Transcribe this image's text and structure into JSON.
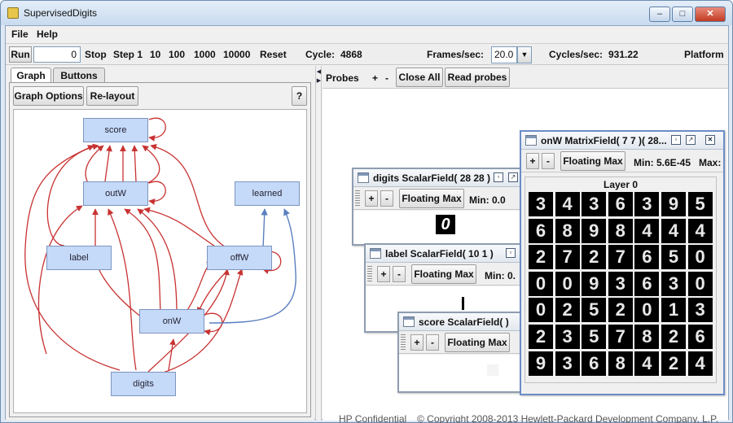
{
  "window": {
    "title": "SupervisedDigits"
  },
  "menu": [
    "File",
    "Help"
  ],
  "toolbar": {
    "run": "Run",
    "cycle_input": "0",
    "stop": "Stop",
    "step1": "Step 1",
    "s10": "10",
    "s100": "100",
    "s1000": "1000",
    "s10000": "10000",
    "reset": "Reset",
    "cycle_label": "Cycle:",
    "cycle_value": "4868",
    "fps_label": "Frames/sec:",
    "fps_value": "20.0",
    "cps_label": "Cycles/sec:",
    "cps_value": "931.22",
    "platform": "Platform"
  },
  "left": {
    "tabs": [
      "Graph",
      "Buttons"
    ],
    "graph_options": "Graph Options",
    "relayout": "Re-layout",
    "help": "?",
    "nodes": [
      "score",
      "outW",
      "learned",
      "label",
      "offW",
      "onW",
      "digits"
    ]
  },
  "probes": {
    "label": "Probes",
    "plus": "+",
    "minus": "-",
    "close_all": "Close All",
    "read_probes": "Read probes"
  },
  "frames": {
    "digits": {
      "title": "digits ScalarField( 28 28 )",
      "floating": "Floating Max",
      "min": "Min: 0.0",
      "glyph": "0"
    },
    "label": {
      "title": "label ScalarField( 10 1 )",
      "floating": "Floating Max",
      "min": "Min: 0."
    },
    "score": {
      "title": "score ScalarField( )",
      "floating": "Floating Max"
    },
    "onw": {
      "title": "onW MatrixField( 7 7 )( 28...",
      "floating": "Floating Max",
      "min": "Min: 5.6E-45",
      "max": "Max:",
      "layer": "Layer 0",
      "grid": [
        [
          "3",
          "4",
          "3",
          "6",
          "3",
          "9",
          "5"
        ],
        [
          "6",
          "8",
          "9",
          "8",
          "4",
          "4",
          "4"
        ],
        [
          "2",
          "7",
          "2",
          "7",
          "6",
          "5",
          "0"
        ],
        [
          "0",
          "0",
          "9",
          "3",
          "6",
          "3",
          "0"
        ],
        [
          "0",
          "2",
          "5",
          "2",
          "0",
          "1",
          "3"
        ],
        [
          "2",
          "3",
          "5",
          "7",
          "8",
          "2",
          "6"
        ],
        [
          "9",
          "3",
          "6",
          "8",
          "4",
          "2",
          "4"
        ]
      ]
    }
  },
  "footer": {
    "confidential": "HP Confidential",
    "copyright": "© Copyright 2008-2013 Hewlett-Packard Development Company, L.P."
  },
  "colors": {
    "node_fill": "#c5d9f8",
    "edge_red": "#c83232",
    "edge_blue": "#5a7fbf"
  }
}
